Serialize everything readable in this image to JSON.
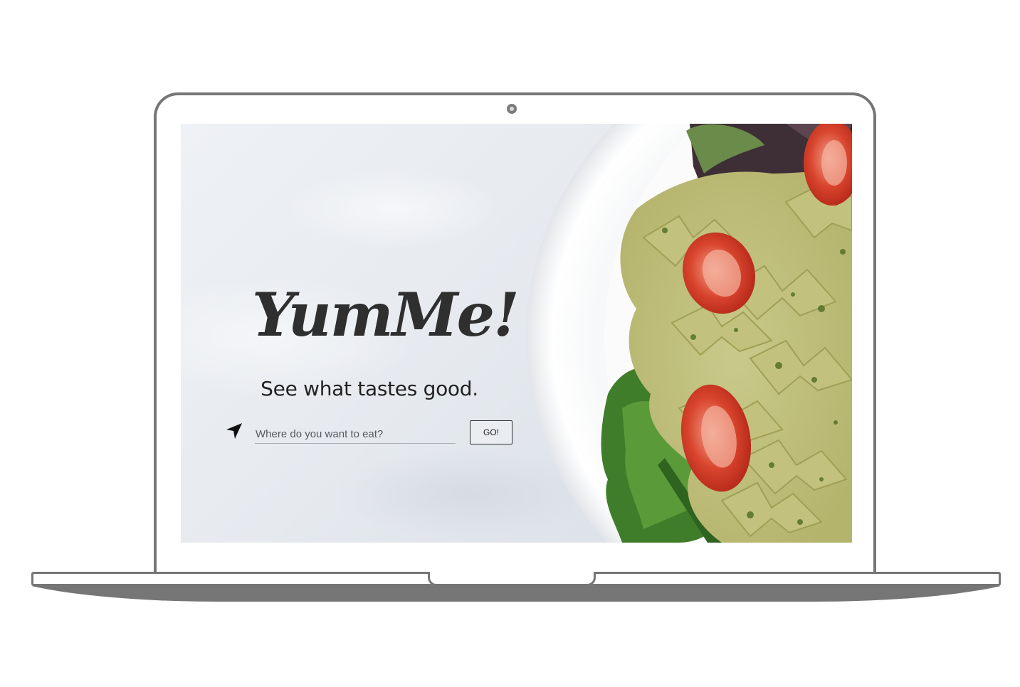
{
  "app": {
    "logo_text": "YumMe!",
    "tagline": "See what tastes good."
  },
  "search": {
    "placeholder": "Where do you want to eat?",
    "value": "",
    "go_label": "GO!",
    "locate_icon": "location-arrow-icon"
  },
  "colors": {
    "laptop_frame": "#767676",
    "logo": "#2f2f2f",
    "text": "#222222"
  }
}
